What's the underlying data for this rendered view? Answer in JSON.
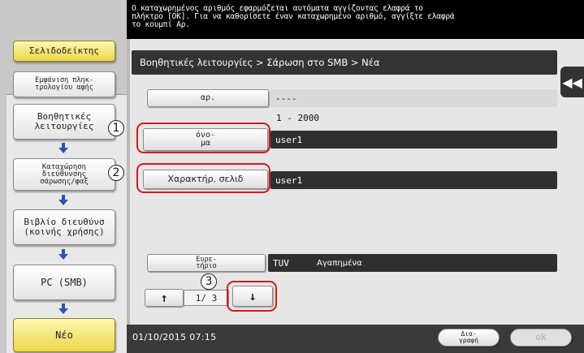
{
  "message": "Ο καταχωρημένος αριθμός εφαρμόζεται αυτόματα αγγίζοντας ελαφρά το\nπλήκτρο [OK]. Για να καθορίσετε έναν καταχωρημένο αριθμό, αγγίξτε ελαφρά\nτο κουμπί Αρ.",
  "sidebar": {
    "bookmark_label": "Σελιδοδείκτης",
    "numeric_keypad_label": "Εμφάνιση πληκ-\nτρολογίου αφής",
    "steps": [
      "Βοηθητικές\nλειτουργίες",
      "Καταχώρηση\nδιεύθυνσης\nσάρωσης/φαξ",
      "Βιβλίο διευθύνσ\n(κοινής χρήσης)",
      "PC (SMB)",
      "Νέο"
    ]
  },
  "breadcrumb": "Βοηθητικές λειτουργίες > Σάρωση στο SMB > Νέα",
  "fields": {
    "number": {
      "label": "αρ.",
      "value": "----",
      "range": "1  -  2000"
    },
    "name": {
      "label": "όνο-\nμα",
      "value": "user1"
    },
    "character": {
      "label": "Χαρακτήρ. σελιδ",
      "value": "user1"
    },
    "index": {
      "label": "Ευρε-\nτήριο",
      "group": "TUV",
      "favorite": "Αγαπημένα"
    }
  },
  "pager": {
    "up_symbol": "↑",
    "page": "1/ 3",
    "down_symbol": "↓"
  },
  "annotations": [
    "1",
    "2",
    "3"
  ],
  "footer": {
    "datetime": "01/10/2015  07:15",
    "delete_label": "Δια-\nγραφή",
    "ok_label": "ok"
  },
  "collapse_symbol": "◀◀",
  "colors": {
    "accent_yellow": "#ecd64a",
    "callout_red": "#d41a1a",
    "arrow_blue": "#2c52b8",
    "dark": "#333333"
  }
}
